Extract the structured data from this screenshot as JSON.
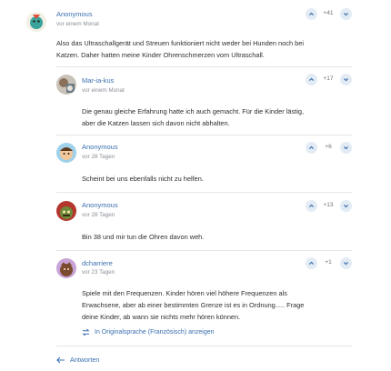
{
  "comments": [
    {
      "author": "Anonymous",
      "time": "vor einem Monat",
      "score": "+41",
      "text": [
        "Also das Ultraschallgerät und Streuen funktioniert nicht weder bei Hunden noch bei",
        "Katzen. Daher hatten meine Kinder Ohrenschmerzen vom Ultraschall."
      ],
      "avatar": "avatar-cartoon-teal"
    },
    {
      "author": "Mar-ia-kus",
      "time": "vor einem Monat",
      "score": "+17",
      "text": [
        "Die genau gleiche Erfahrung hatte ich auch gemacht. Für die Kinder lästig,",
        "aber die Katzen lassen sich davon nicht abhalten."
      ],
      "avatar": "avatar-photo"
    },
    {
      "author": "Anonymous",
      "time": "vor 28 Tagen",
      "score": "+6",
      "text": [
        "Scheint bei uns ebenfalls nicht zu helfen."
      ],
      "avatar": "avatar-cartoon-blue"
    },
    {
      "author": "Anonymous",
      "time": "vor 28 Tagen",
      "score": "+13",
      "text": [
        "Bin 38 und mir tun die Ohren davon weh."
      ],
      "avatar": "avatar-cartoon-red"
    },
    {
      "author": "dcharriere",
      "time": "vor 23 Tagen",
      "score": "+1",
      "text": [
        "Spiele mit den Frequenzen. Kinder hören viel höhere Frequenzen als",
        "Erwachsene, aber ab einer bestimmten Grenze ist es in Ordnung..... Frage",
        "deine Kinder, ab wann sie nichts mehr hören können."
      ],
      "avatar": "avatar-cartoon-purple"
    }
  ],
  "translate_label": "In Originalsprache (Französisch) anzeigen",
  "reply_label": "Antworten",
  "colors": {
    "link": "#3a6fb0",
    "vote_bg": "#e3ebf4",
    "divider": "#e4e6ea"
  }
}
